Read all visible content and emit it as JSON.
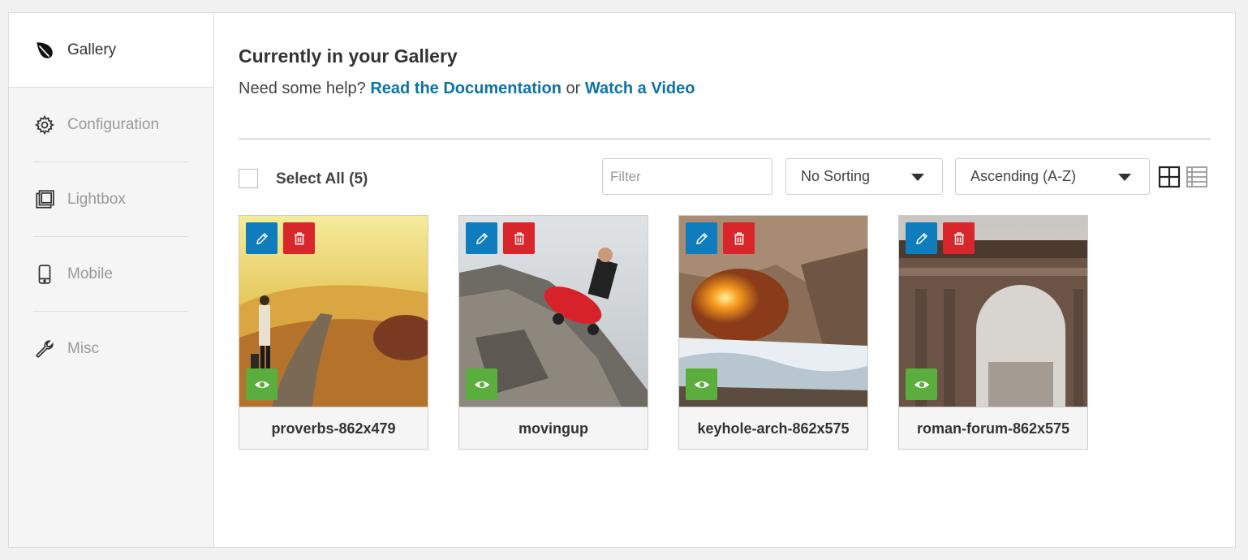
{
  "sidebar": {
    "items": [
      {
        "label": "Gallery",
        "icon": "leaf-icon"
      },
      {
        "label": "Configuration",
        "icon": "gear-icon"
      },
      {
        "label": "Lightbox",
        "icon": "lightbox-icon"
      },
      {
        "label": "Mobile",
        "icon": "mobile-icon"
      },
      {
        "label": "Misc",
        "icon": "wrench-icon"
      }
    ]
  },
  "main": {
    "title": "Currently in your Gallery",
    "help_prefix": "Need some help?",
    "doc_link": "Read the Documentation",
    "or_text": "or",
    "video_link": "Watch a Video"
  },
  "toolbar": {
    "select_all": "Select All (5)",
    "filter_placeholder": "Filter",
    "sorting": "No Sorting",
    "order": "Ascending (A-Z)"
  },
  "images": [
    {
      "name": "proverbs-862x479"
    },
    {
      "name": "movingup"
    },
    {
      "name": "keyhole-arch-862x575"
    },
    {
      "name": "roman-forum-862x575"
    }
  ],
  "colors": {
    "link": "#0a73aa",
    "edit": "#0f7cbd",
    "delete": "#d9262a",
    "view": "#5aae3e"
  }
}
